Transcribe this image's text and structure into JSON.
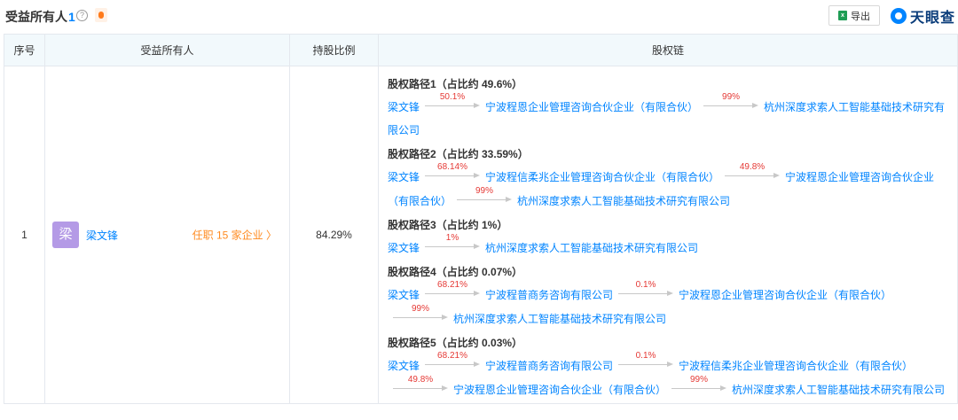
{
  "header": {
    "title": "受益所有人",
    "count": "1",
    "help": "?",
    "export_label": "导出",
    "excel_glyph": "x",
    "brand": "天眼查"
  },
  "table": {
    "columns": [
      "序号",
      "受益所有人",
      "持股比例",
      "股权链"
    ],
    "row": {
      "no": "1",
      "avatar": "梁",
      "owner": "梁文锋",
      "positions": "任职 15 家企业 〉",
      "ratio": "84.29%",
      "paths": [
        {
          "title": "股权路径1（占比约 49.6%）",
          "start": "梁文锋",
          "links": [
            {
              "pct": "50.1%",
              "to": "宁波程恩企业管理咨询合伙企业（有限合伙）"
            },
            {
              "pct": "99%",
              "to": "杭州深度求索人工智能基础技术研究有限公司"
            }
          ]
        },
        {
          "title": "股权路径2（占比约 33.59%）",
          "start": "梁文锋",
          "links": [
            {
              "pct": "68.14%",
              "to": "宁波程信柔兆企业管理咨询合伙企业（有限合伙）"
            },
            {
              "pct": "49.8%",
              "to": "宁波程恩企业管理咨询合伙企业（有限合伙）"
            },
            {
              "pct": "99%",
              "to": "杭州深度求索人工智能基础技术研究有限公司"
            }
          ]
        },
        {
          "title": "股权路径3（占比约 1%）",
          "start": "梁文锋",
          "links": [
            {
              "pct": "1%",
              "to": "杭州深度求索人工智能基础技术研究有限公司"
            }
          ]
        },
        {
          "title": "股权路径4（占比约 0.07%）",
          "start": "梁文锋",
          "links": [
            {
              "pct": "68.21%",
              "to": "宁波程普商务咨询有限公司"
            },
            {
              "pct": "0.1%",
              "to": "宁波程恩企业管理咨询合伙企业（有限合伙）"
            },
            {
              "pct": "99%",
              "to": "杭州深度求索人工智能基础技术研究有限公司"
            }
          ]
        },
        {
          "title": "股权路径5（占比约 0.03%）",
          "start": "梁文锋",
          "links": [
            {
              "pct": "68.21%",
              "to": "宁波程普商务咨询有限公司"
            },
            {
              "pct": "0.1%",
              "to": "宁波程信柔兆企业管理咨询合伙企业（有限合伙）"
            },
            {
              "pct": "49.8%",
              "to": "宁波程恩企业管理咨询合伙企业（有限合伙）"
            },
            {
              "pct": "99%",
              "to": "杭州深度求索人工智能基础技术研究有限公司"
            }
          ]
        }
      ]
    }
  }
}
